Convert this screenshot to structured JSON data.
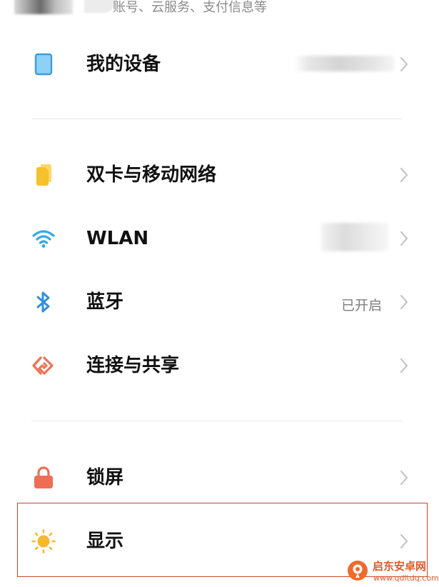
{
  "account": {
    "subtitle": "账号、云服务、支付信息等"
  },
  "groups": [
    {
      "items": [
        {
          "label": "我的设备",
          "value": "",
          "icon": "phone-device-icon"
        }
      ]
    },
    {
      "items": [
        {
          "label": "双卡与移动网络",
          "value": "",
          "icon": "sim-card-icon"
        },
        {
          "label": "WLAN",
          "value": "",
          "icon": "wifi-icon"
        },
        {
          "label": "蓝牙",
          "value": "已开启",
          "icon": "bluetooth-icon"
        },
        {
          "label": "连接与共享",
          "value": "",
          "icon": "connection-share-icon"
        }
      ]
    },
    {
      "items": [
        {
          "label": "锁屏",
          "value": "",
          "icon": "lock-icon"
        },
        {
          "label": "显示",
          "value": "",
          "icon": "sun-brightness-icon"
        }
      ]
    }
  ],
  "highlighted_item": "显示",
  "colors": {
    "device_icon": "#5db4ec",
    "sim_icon": "#f6c12c",
    "wifi_icon": "#32a8e6",
    "bluetooth_icon": "#2f8fe0",
    "share_icon": "#ef7456",
    "lock_icon": "#ee6e55",
    "sun_icon": "#f8b82c",
    "highlight_border": "#c8452e",
    "chevron": "#c6c6c6"
  },
  "watermark": {
    "title": "启东安卓网",
    "url": "www.qdltdq.com"
  }
}
